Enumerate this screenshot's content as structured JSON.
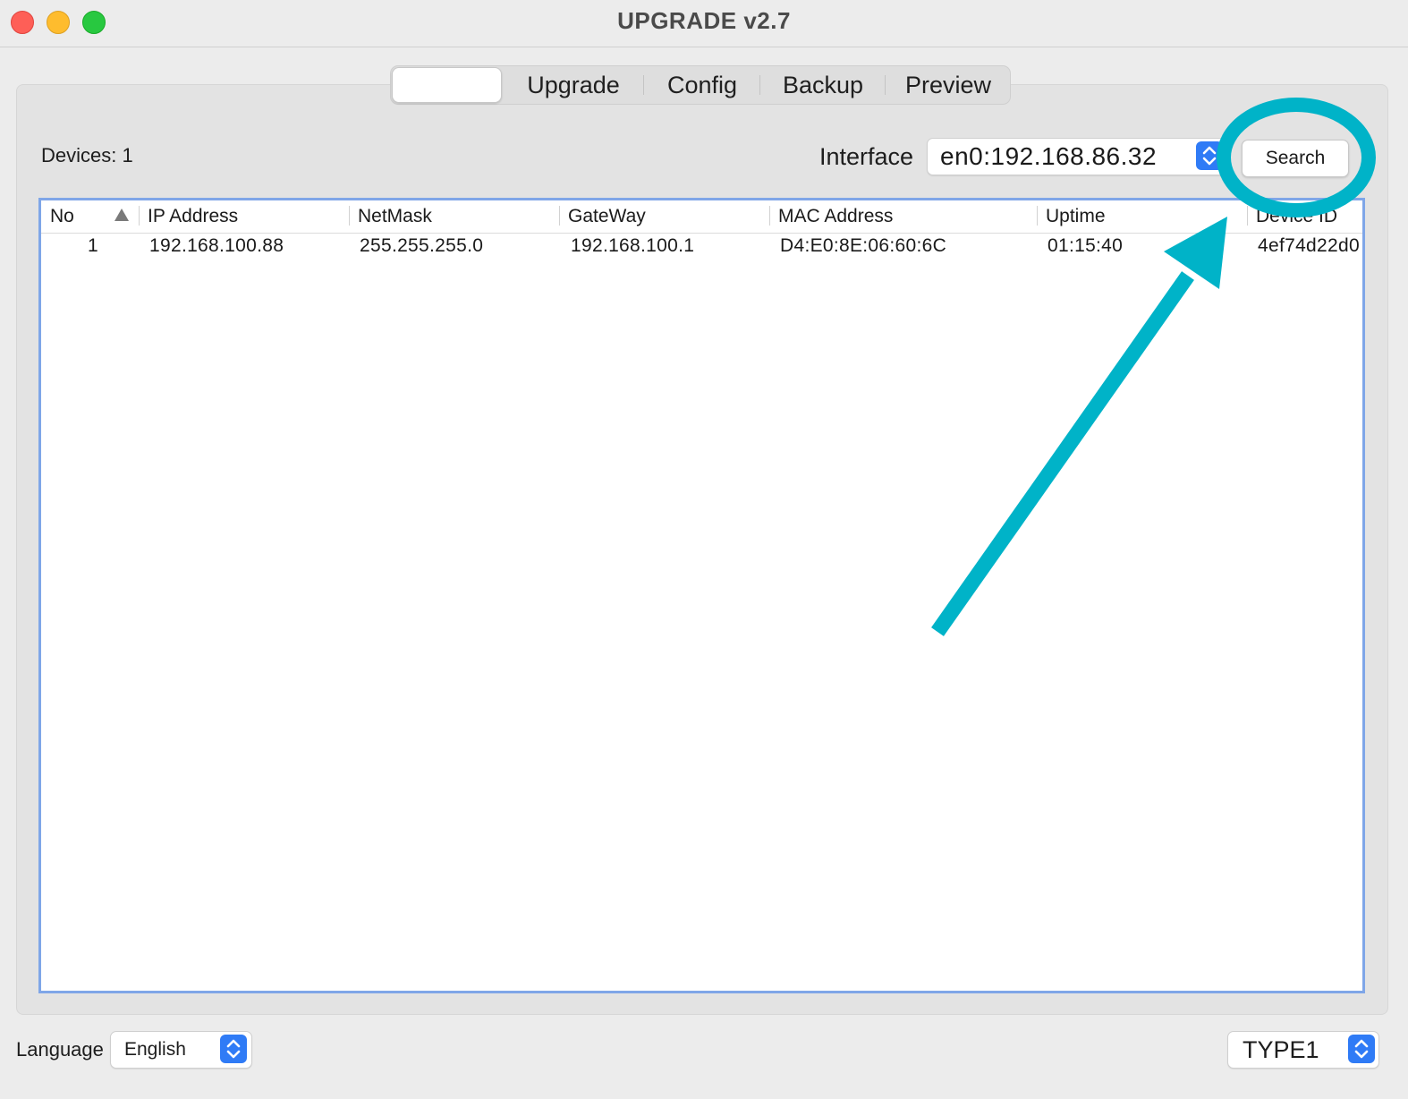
{
  "window": {
    "title": "UPGRADE v2.7"
  },
  "tabs": [
    {
      "label": ""
    },
    {
      "label": "Upgrade"
    },
    {
      "label": "Config"
    },
    {
      "label": "Backup"
    },
    {
      "label": "Preview"
    }
  ],
  "toolbar": {
    "devices_label": "Devices: 1",
    "interface_label": "Interface",
    "interface_value": "en0:192.168.86.32",
    "search_label": "Search"
  },
  "table": {
    "columns": [
      "No",
      "IP Address",
      "NetMask",
      "GateWay",
      "MAC Address",
      "Uptime",
      "Device ID"
    ],
    "rows": [
      [
        "1",
        "192.168.100.88",
        "255.255.255.0",
        "192.168.100.1",
        "D4:E0:8E:06:60:6C",
        "01:15:40",
        "4ef74d22d0"
      ]
    ]
  },
  "footer": {
    "language_label": "Language",
    "language_value": "English",
    "type_value": "TYPE1"
  },
  "colors": {
    "accent": "#2f7bf6",
    "annotation": "#00b3c8",
    "table_focus_border": "#7fa6e8"
  },
  "icons": {
    "sort": "triangle-up-icon",
    "stepper": "chevron-up-down-icon",
    "annotation": [
      "annotation-circle",
      "annotation-arrow"
    ]
  }
}
